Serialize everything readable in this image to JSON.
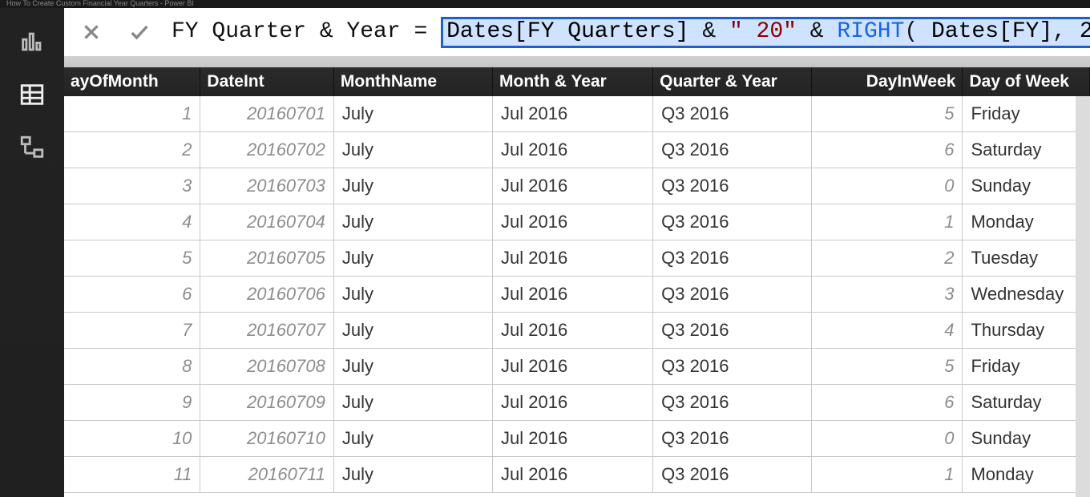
{
  "app": {
    "title": "How To Create Custom Financial Year Quarters - Power BI"
  },
  "formula": {
    "measure_name": "FY Quarter & Year",
    "equals": " = ",
    "expr_col1": "Dates[FY Quarters]",
    "expr_amp1": " & ",
    "expr_str": "\" 20\"",
    "expr_amp2": " & ",
    "expr_fn": "RIGHT",
    "expr_open": "( ",
    "expr_col2": "Dates[FY]",
    "expr_comma": ", ",
    "expr_num": "2",
    "expr_close": " )"
  },
  "view_icons": {
    "report": "report-view",
    "data": "data-view",
    "model": "model-view"
  },
  "columns": {
    "dom": "ayOfMonth",
    "dint": "DateInt",
    "mon": "MonthName",
    "my": "Month & Year",
    "qy": "Quarter & Year",
    "diw": "DayInWeek",
    "dow": "Day of Week"
  },
  "rows": [
    {
      "dom": "1",
      "dint": "20160701",
      "mon": "July",
      "my": "Jul 2016",
      "qy": "Q3 2016",
      "diw": "5",
      "dow": "Friday"
    },
    {
      "dom": "2",
      "dint": "20160702",
      "mon": "July",
      "my": "Jul 2016",
      "qy": "Q3 2016",
      "diw": "6",
      "dow": "Saturday"
    },
    {
      "dom": "3",
      "dint": "20160703",
      "mon": "July",
      "my": "Jul 2016",
      "qy": "Q3 2016",
      "diw": "0",
      "dow": "Sunday"
    },
    {
      "dom": "4",
      "dint": "20160704",
      "mon": "July",
      "my": "Jul 2016",
      "qy": "Q3 2016",
      "diw": "1",
      "dow": "Monday"
    },
    {
      "dom": "5",
      "dint": "20160705",
      "mon": "July",
      "my": "Jul 2016",
      "qy": "Q3 2016",
      "diw": "2",
      "dow": "Tuesday"
    },
    {
      "dom": "6",
      "dint": "20160706",
      "mon": "July",
      "my": "Jul 2016",
      "qy": "Q3 2016",
      "diw": "3",
      "dow": "Wednesday"
    },
    {
      "dom": "7",
      "dint": "20160707",
      "mon": "July",
      "my": "Jul 2016",
      "qy": "Q3 2016",
      "diw": "4",
      "dow": "Thursday"
    },
    {
      "dom": "8",
      "dint": "20160708",
      "mon": "July",
      "my": "Jul 2016",
      "qy": "Q3 2016",
      "diw": "5",
      "dow": "Friday"
    },
    {
      "dom": "9",
      "dint": "20160709",
      "mon": "July",
      "my": "Jul 2016",
      "qy": "Q3 2016",
      "diw": "6",
      "dow": "Saturday"
    },
    {
      "dom": "10",
      "dint": "20160710",
      "mon": "July",
      "my": "Jul 2016",
      "qy": "Q3 2016",
      "diw": "0",
      "dow": "Sunday"
    },
    {
      "dom": "11",
      "dint": "20160711",
      "mon": "July",
      "my": "Jul 2016",
      "qy": "Q3 2016",
      "diw": "1",
      "dow": "Monday"
    }
  ]
}
